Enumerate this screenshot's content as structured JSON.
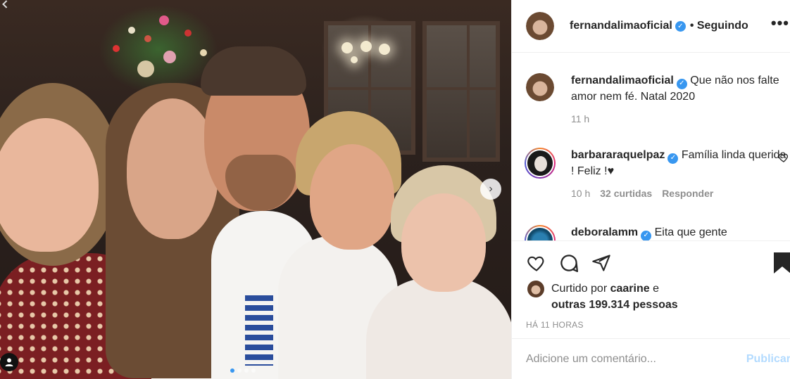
{
  "post": {
    "author": "fernandalimaoficial",
    "follow_status": "• Seguindo",
    "more_label": "•••",
    "caption_text": "Que não nos falte amor nem fé. Natal 2020",
    "caption_age": "11 h",
    "carousel_next_label": "›"
  },
  "comments": [
    {
      "username": "barbararaquelpaz",
      "text": "Família linda querida ! Feliz !♥",
      "age": "10 h",
      "likes": "32 curtidas",
      "reply_label": "Responder"
    },
    {
      "username": "deboralamm",
      "text": "Eita que gente"
    }
  ],
  "likes": {
    "prefix": "Curtido por",
    "first_user": "caarine",
    "connector": "e",
    "others": "outras 199.314 pessoas"
  },
  "timestamp": "HÁ 11 HORAS",
  "add_comment": {
    "placeholder": "Adicione um comentário...",
    "publish_label": "Publicar"
  },
  "colors": {
    "verified": "#3897f0",
    "publish_disabled": "#b3dbff",
    "secondary_text": "#8e8e8e"
  },
  "icons": [
    "heart-icon",
    "comment-icon",
    "share-icon",
    "bookmark-icon",
    "verified-icon",
    "more-icon",
    "chevron-right-icon",
    "user-tag-icon"
  ]
}
